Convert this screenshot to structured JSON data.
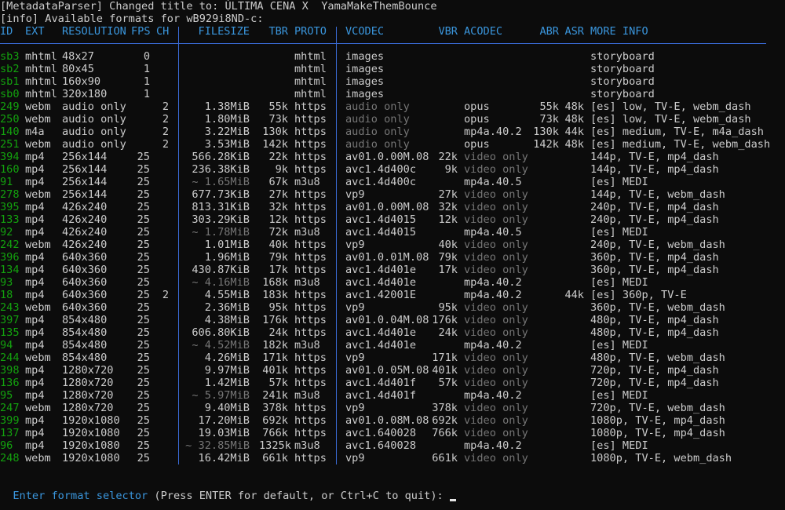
{
  "header_lines": [
    "[MetadataParser] Changed title to: ÚLTIMA CENA X  YamaMakeThemBounce",
    "[info] Available formats for wB929i8ND-c:"
  ],
  "columns": [
    "ID",
    "EXT",
    "RESOLUTION",
    "FPS",
    "CH",
    "FILESIZE",
    "TBR",
    "PROTO",
    "VCODEC",
    "VBR",
    "ACODEC",
    "ABR",
    "ASR",
    "MORE INFO"
  ],
  "rows": [
    {
      "id": "sb3",
      "ext": "mhtml",
      "res": "48x27",
      "fps": "0",
      "ch": "",
      "size": "",
      "tbr": "",
      "proto": "mhtml",
      "vcodec": "images",
      "vbr": "",
      "acodec": "",
      "abr": "",
      "asr": "",
      "info": "storyboard"
    },
    {
      "id": "sb2",
      "ext": "mhtml",
      "res": "80x45",
      "fps": "1",
      "ch": "",
      "size": "",
      "tbr": "",
      "proto": "mhtml",
      "vcodec": "images",
      "vbr": "",
      "acodec": "",
      "abr": "",
      "asr": "",
      "info": "storyboard"
    },
    {
      "id": "sb1",
      "ext": "mhtml",
      "res": "160x90",
      "fps": "1",
      "ch": "",
      "size": "",
      "tbr": "",
      "proto": "mhtml",
      "vcodec": "images",
      "vbr": "",
      "acodec": "",
      "abr": "",
      "asr": "",
      "info": "storyboard"
    },
    {
      "id": "sb0",
      "ext": "mhtml",
      "res": "320x180",
      "fps": "1",
      "ch": "",
      "size": "",
      "tbr": "",
      "proto": "mhtml",
      "vcodec": "images",
      "vbr": "",
      "acodec": "",
      "abr": "",
      "asr": "",
      "info": "storyboard"
    },
    {
      "id": "249",
      "ext": "webm",
      "res": "audio only",
      "fps": "",
      "ch": "2",
      "size": "1.38MiB",
      "tbr": "55k",
      "proto": "https",
      "vcodec": "audio only",
      "vbr": "",
      "acodec": "opus",
      "abr": "55k",
      "asr": "48k",
      "info": "[es] low, TV-E, webm_dash"
    },
    {
      "id": "250",
      "ext": "webm",
      "res": "audio only",
      "fps": "",
      "ch": "2",
      "size": "1.80MiB",
      "tbr": "73k",
      "proto": "https",
      "vcodec": "audio only",
      "vbr": "",
      "acodec": "opus",
      "abr": "73k",
      "asr": "48k",
      "info": "[es] low, TV-E, webm_dash"
    },
    {
      "id": "140",
      "ext": "m4a",
      "res": "audio only",
      "fps": "",
      "ch": "2",
      "size": "3.22MiB",
      "tbr": "130k",
      "proto": "https",
      "vcodec": "audio only",
      "vbr": "",
      "acodec": "mp4a.40.2",
      "abr": "130k",
      "asr": "44k",
      "info": "[es] medium, TV-E, m4a_dash"
    },
    {
      "id": "251",
      "ext": "webm",
      "res": "audio only",
      "fps": "",
      "ch": "2",
      "size": "3.53MiB",
      "tbr": "142k",
      "proto": "https",
      "vcodec": "audio only",
      "vbr": "",
      "acodec": "opus",
      "abr": "142k",
      "asr": "48k",
      "info": "[es] medium, TV-E, webm_dash"
    },
    {
      "id": "394",
      "ext": "mp4",
      "res": "256x144",
      "fps": "25",
      "ch": "",
      "size": "566.28KiB",
      "tbr": "22k",
      "proto": "https",
      "vcodec": "av01.0.00M.08",
      "vbr": "22k",
      "acodec": "video only",
      "abr": "",
      "asr": "",
      "info": "144p, TV-E, mp4_dash"
    },
    {
      "id": "160",
      "ext": "mp4",
      "res": "256x144",
      "fps": "25",
      "ch": "",
      "size": "236.38KiB",
      "tbr": "9k",
      "proto": "https",
      "vcodec": "avc1.4d400c",
      "vbr": "9k",
      "acodec": "video only",
      "abr": "",
      "asr": "",
      "info": "144p, TV-E, mp4_dash"
    },
    {
      "id": "91",
      "ext": "mp4",
      "res": "256x144",
      "fps": "25",
      "ch": "",
      "size": "~ 1.65MiB",
      "tbr": "67k",
      "proto": "m3u8",
      "vcodec": "avc1.4d400c",
      "vbr": "",
      "acodec": "mp4a.40.5",
      "abr": "",
      "asr": "",
      "info": "[es] MEDI"
    },
    {
      "id": "278",
      "ext": "webm",
      "res": "256x144",
      "fps": "25",
      "ch": "",
      "size": "677.73KiB",
      "tbr": "27k",
      "proto": "https",
      "vcodec": "vp9",
      "vbr": "27k",
      "acodec": "video only",
      "abr": "",
      "asr": "",
      "info": "144p, TV-E, webm_dash"
    },
    {
      "id": "395",
      "ext": "mp4",
      "res": "426x240",
      "fps": "25",
      "ch": "",
      "size": "813.31KiB",
      "tbr": "32k",
      "proto": "https",
      "vcodec": "av01.0.00M.08",
      "vbr": "32k",
      "acodec": "video only",
      "abr": "",
      "asr": "",
      "info": "240p, TV-E, mp4_dash"
    },
    {
      "id": "133",
      "ext": "mp4",
      "res": "426x240",
      "fps": "25",
      "ch": "",
      "size": "303.29KiB",
      "tbr": "12k",
      "proto": "https",
      "vcodec": "avc1.4d4015",
      "vbr": "12k",
      "acodec": "video only",
      "abr": "",
      "asr": "",
      "info": "240p, TV-E, mp4_dash"
    },
    {
      "id": "92",
      "ext": "mp4",
      "res": "426x240",
      "fps": "25",
      "ch": "",
      "size": "~ 1.78MiB",
      "tbr": "72k",
      "proto": "m3u8",
      "vcodec": "avc1.4d4015",
      "vbr": "",
      "acodec": "mp4a.40.5",
      "abr": "",
      "asr": "",
      "info": "[es] MEDI"
    },
    {
      "id": "242",
      "ext": "webm",
      "res": "426x240",
      "fps": "25",
      "ch": "",
      "size": "1.01MiB",
      "tbr": "40k",
      "proto": "https",
      "vcodec": "vp9",
      "vbr": "40k",
      "acodec": "video only",
      "abr": "",
      "asr": "",
      "info": "240p, TV-E, webm_dash"
    },
    {
      "id": "396",
      "ext": "mp4",
      "res": "640x360",
      "fps": "25",
      "ch": "",
      "size": "1.96MiB",
      "tbr": "79k",
      "proto": "https",
      "vcodec": "av01.0.01M.08",
      "vbr": "79k",
      "acodec": "video only",
      "abr": "",
      "asr": "",
      "info": "360p, TV-E, mp4_dash"
    },
    {
      "id": "134",
      "ext": "mp4",
      "res": "640x360",
      "fps": "25",
      "ch": "",
      "size": "430.87KiB",
      "tbr": "17k",
      "proto": "https",
      "vcodec": "avc1.4d401e",
      "vbr": "17k",
      "acodec": "video only",
      "abr": "",
      "asr": "",
      "info": "360p, TV-E, mp4_dash"
    },
    {
      "id": "93",
      "ext": "mp4",
      "res": "640x360",
      "fps": "25",
      "ch": "",
      "size": "~ 4.16MiB",
      "tbr": "168k",
      "proto": "m3u8",
      "vcodec": "avc1.4d401e",
      "vbr": "",
      "acodec": "mp4a.40.2",
      "abr": "",
      "asr": "",
      "info": "[es] MEDI"
    },
    {
      "id": "18",
      "ext": "mp4",
      "res": "640x360",
      "fps": "25",
      "ch": "2",
      "size": "4.55MiB",
      "tbr": "183k",
      "proto": "https",
      "vcodec": "avc1.42001E",
      "vbr": "",
      "acodec": "mp4a.40.2",
      "abr": "",
      "asr": "44k",
      "info": "[es] 360p, TV-E"
    },
    {
      "id": "243",
      "ext": "webm",
      "res": "640x360",
      "fps": "25",
      "ch": "",
      "size": "2.36MiB",
      "tbr": "95k",
      "proto": "https",
      "vcodec": "vp9",
      "vbr": "95k",
      "acodec": "video only",
      "abr": "",
      "asr": "",
      "info": "360p, TV-E, webm_dash"
    },
    {
      "id": "397",
      "ext": "mp4",
      "res": "854x480",
      "fps": "25",
      "ch": "",
      "size": "4.38MiB",
      "tbr": "176k",
      "proto": "https",
      "vcodec": "av01.0.04M.08",
      "vbr": "176k",
      "acodec": "video only",
      "abr": "",
      "asr": "",
      "info": "480p, TV-E, mp4_dash"
    },
    {
      "id": "135",
      "ext": "mp4",
      "res": "854x480",
      "fps": "25",
      "ch": "",
      "size": "606.80KiB",
      "tbr": "24k",
      "proto": "https",
      "vcodec": "avc1.4d401e",
      "vbr": "24k",
      "acodec": "video only",
      "abr": "",
      "asr": "",
      "info": "480p, TV-E, mp4_dash"
    },
    {
      "id": "94",
      "ext": "mp4",
      "res": "854x480",
      "fps": "25",
      "ch": "",
      "size": "~ 4.52MiB",
      "tbr": "182k",
      "proto": "m3u8",
      "vcodec": "avc1.4d401e",
      "vbr": "",
      "acodec": "mp4a.40.2",
      "abr": "",
      "asr": "",
      "info": "[es] MEDI"
    },
    {
      "id": "244",
      "ext": "webm",
      "res": "854x480",
      "fps": "25",
      "ch": "",
      "size": "4.26MiB",
      "tbr": "171k",
      "proto": "https",
      "vcodec": "vp9",
      "vbr": "171k",
      "acodec": "video only",
      "abr": "",
      "asr": "",
      "info": "480p, TV-E, webm_dash"
    },
    {
      "id": "398",
      "ext": "mp4",
      "res": "1280x720",
      "fps": "25",
      "ch": "",
      "size": "9.97MiB",
      "tbr": "401k",
      "proto": "https",
      "vcodec": "av01.0.05M.08",
      "vbr": "401k",
      "acodec": "video only",
      "abr": "",
      "asr": "",
      "info": "720p, TV-E, mp4_dash"
    },
    {
      "id": "136",
      "ext": "mp4",
      "res": "1280x720",
      "fps": "25",
      "ch": "",
      "size": "1.42MiB",
      "tbr": "57k",
      "proto": "https",
      "vcodec": "avc1.4d401f",
      "vbr": "57k",
      "acodec": "video only",
      "abr": "",
      "asr": "",
      "info": "720p, TV-E, mp4_dash"
    },
    {
      "id": "95",
      "ext": "mp4",
      "res": "1280x720",
      "fps": "25",
      "ch": "",
      "size": "~ 5.97MiB",
      "tbr": "241k",
      "proto": "m3u8",
      "vcodec": "avc1.4d401f",
      "vbr": "",
      "acodec": "mp4a.40.2",
      "abr": "",
      "asr": "",
      "info": "[es] MEDI"
    },
    {
      "id": "247",
      "ext": "webm",
      "res": "1280x720",
      "fps": "25",
      "ch": "",
      "size": "9.40MiB",
      "tbr": "378k",
      "proto": "https",
      "vcodec": "vp9",
      "vbr": "378k",
      "acodec": "video only",
      "abr": "",
      "asr": "",
      "info": "720p, TV-E, webm_dash"
    },
    {
      "id": "399",
      "ext": "mp4",
      "res": "1920x1080",
      "fps": "25",
      "ch": "",
      "size": "17.20MiB",
      "tbr": "692k",
      "proto": "https",
      "vcodec": "av01.0.08M.08",
      "vbr": "692k",
      "acodec": "video only",
      "abr": "",
      "asr": "",
      "info": "1080p, TV-E, mp4_dash"
    },
    {
      "id": "137",
      "ext": "mp4",
      "res": "1920x1080",
      "fps": "25",
      "ch": "",
      "size": "19.03MiB",
      "tbr": "766k",
      "proto": "https",
      "vcodec": "avc1.640028",
      "vbr": "766k",
      "acodec": "video only",
      "abr": "",
      "asr": "",
      "info": "1080p, TV-E, mp4_dash"
    },
    {
      "id": "96",
      "ext": "mp4",
      "res": "1920x1080",
      "fps": "25",
      "ch": "",
      "size": "~ 32.85MiB",
      "tbr": "1325k",
      "proto": "m3u8",
      "vcodec": "avc1.640028",
      "vbr": "",
      "acodec": "mp4a.40.2",
      "abr": "",
      "asr": "",
      "info": "[es] MEDI"
    },
    {
      "id": "248",
      "ext": "webm",
      "res": "1920x1080",
      "fps": "25",
      "ch": "",
      "size": "16.42MiB",
      "tbr": "661k",
      "proto": "https",
      "vcodec": "vp9",
      "vbr": "661k",
      "acodec": "video only",
      "abr": "",
      "asr": "",
      "info": "1080p, TV-E, webm_dash"
    }
  ],
  "prompt": {
    "label": "Enter format selector",
    "hint": " (Press ENTER for default, or Ctrl+C to quit): "
  },
  "colors": {
    "background": "#0c0c0c",
    "text": "#cccccc",
    "header": "#3a96dd",
    "id": "#13a10e",
    "dim": "#767676",
    "separator": "#3a6bd6"
  }
}
